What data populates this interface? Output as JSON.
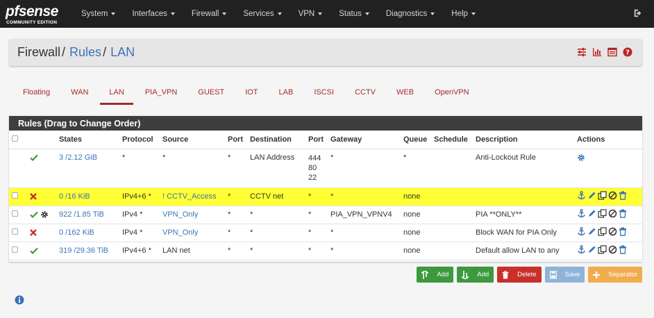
{
  "brand": {
    "logo": "pfsense",
    "edition": "COMMUNITY EDITION"
  },
  "nav": [
    {
      "label": "System"
    },
    {
      "label": "Interfaces"
    },
    {
      "label": "Firewall"
    },
    {
      "label": "Services"
    },
    {
      "label": "VPN"
    },
    {
      "label": "Status"
    },
    {
      "label": "Diagnostics"
    },
    {
      "label": "Help"
    }
  ],
  "breadcrumb": {
    "part1": "Firewall",
    "part2": "Rules",
    "part3": "LAN",
    "sep": "/"
  },
  "tabs": [
    "Floating",
    "WAN",
    "LAN",
    "PIA_VPN",
    "GUEST",
    "IOT",
    "LAB",
    "ISCSI",
    "CCTV",
    "WEB",
    "OpenVPN"
  ],
  "active_tab": "LAN",
  "rules": {
    "heading": "Rules (Drag to Change Order)",
    "columns": [
      "States",
      "Protocol",
      "Source",
      "Port",
      "Destination",
      "Port",
      "Gateway",
      "Queue",
      "Schedule",
      "Description",
      "Actions"
    ],
    "rows": [
      {
        "status": "pass",
        "states": "3 /2.12 GiB",
        "protocol": "*",
        "source": "*",
        "sport": "*",
        "destination": "LAN Address",
        "dport1": "444",
        "dport2": "80",
        "dport3": "22",
        "gateway": "*",
        "queue": "*",
        "schedule": "",
        "description": "Anti-Lockout Rule"
      },
      {
        "status": "block",
        "states": "0 /16 KiB",
        "protocol": "IPv4+6 *",
        "source": "! CCTV_Access",
        "sport": "*",
        "destination": "CCTV net",
        "dport": "*",
        "gateway": "*",
        "queue": "none",
        "schedule": "",
        "description": ""
      },
      {
        "status": "pass",
        "states": "922 /1.85 TiB",
        "protocol": "IPv4 *",
        "source": "VPN_Only",
        "sport": "*",
        "destination": "*",
        "dport": "*",
        "gateway": "PIA_VPN_VPNV4",
        "queue": "none",
        "schedule": "",
        "description": "PIA **ONLY**"
      },
      {
        "status": "block",
        "states": "0 /162 KiB",
        "protocol": "IPv4 *",
        "source": "VPN_Only",
        "sport": "*",
        "destination": "*",
        "dport": "*",
        "gateway": "*",
        "queue": "none",
        "schedule": "",
        "description": "Block WAN for PIA Only"
      },
      {
        "status": "pass",
        "states": "319 /29.36 TiB",
        "protocol": "IPv4+6 *",
        "source": "LAN net",
        "sport": "*",
        "destination": "*",
        "dport": "*",
        "gateway": "*",
        "queue": "none",
        "schedule": "",
        "description": "Default allow LAN to any"
      }
    ]
  },
  "buttons": {
    "add_top": "Add",
    "add_bottom": "Add",
    "delete": "Delete",
    "save": "Save",
    "separator": "Separator"
  },
  "colors": {
    "navbar": "#212121",
    "link": "#3b73b9",
    "tab": "#a52a2a",
    "highlight": "#ffff33",
    "pass": "#3d993d",
    "block": "#c9302c"
  }
}
